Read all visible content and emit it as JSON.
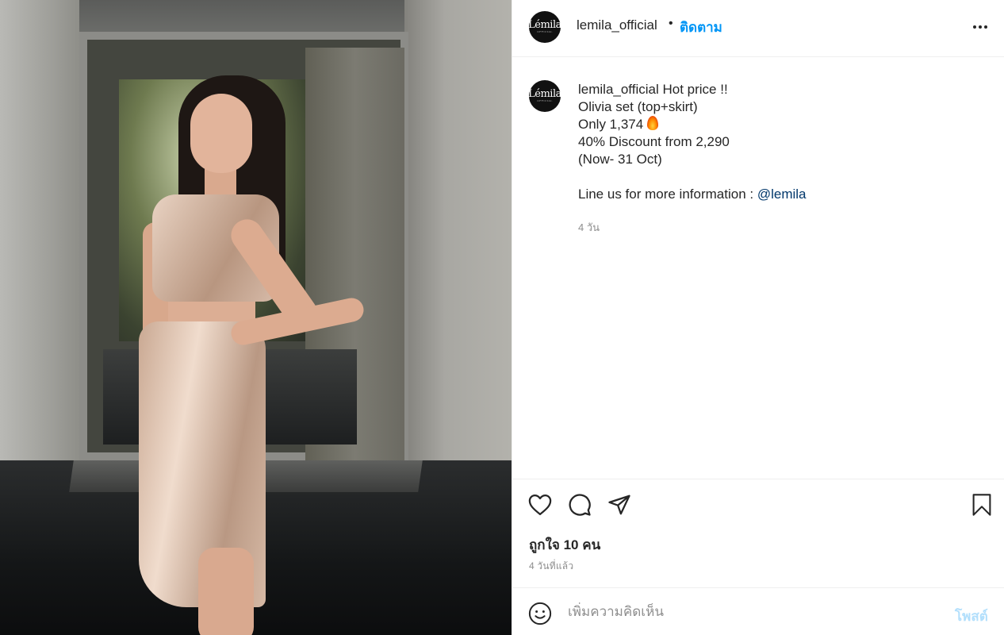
{
  "post": {
    "username": "lemila_official",
    "separator": "•",
    "follow_label": "ติดตาม",
    "avatar_text": "Lémila",
    "avatar_subtext": "OFFICIAL"
  },
  "caption": {
    "username": "lemila_official",
    "line1": "Hot price !!",
    "line2": "Olivia set (top+skirt)",
    "line3": "Only 1,374",
    "line4": "40% Discount from 2,290",
    "line5": "(Now- 31 Oct)",
    "line6_prefix": "Line us for more information : ",
    "mention": "@lemila",
    "age": "4 วัน"
  },
  "engagement": {
    "likes": "ถูกใจ 10 คน",
    "time_ago": "4 วันที่แล้ว"
  },
  "comment_box": {
    "placeholder": "เพิ่มความคิดเห็น",
    "post_label": "โพสต์"
  },
  "icons": {
    "like": "heart-icon",
    "comment": "comment-icon",
    "share": "paper-plane-icon",
    "save": "bookmark-icon",
    "emoji": "smiley-icon",
    "more": "more-options-icon"
  },
  "colors": {
    "follow": "#0095f6",
    "mention": "#00376b",
    "post_disabled": "#b2dffc",
    "secondary_text": "#8e8e8e"
  }
}
